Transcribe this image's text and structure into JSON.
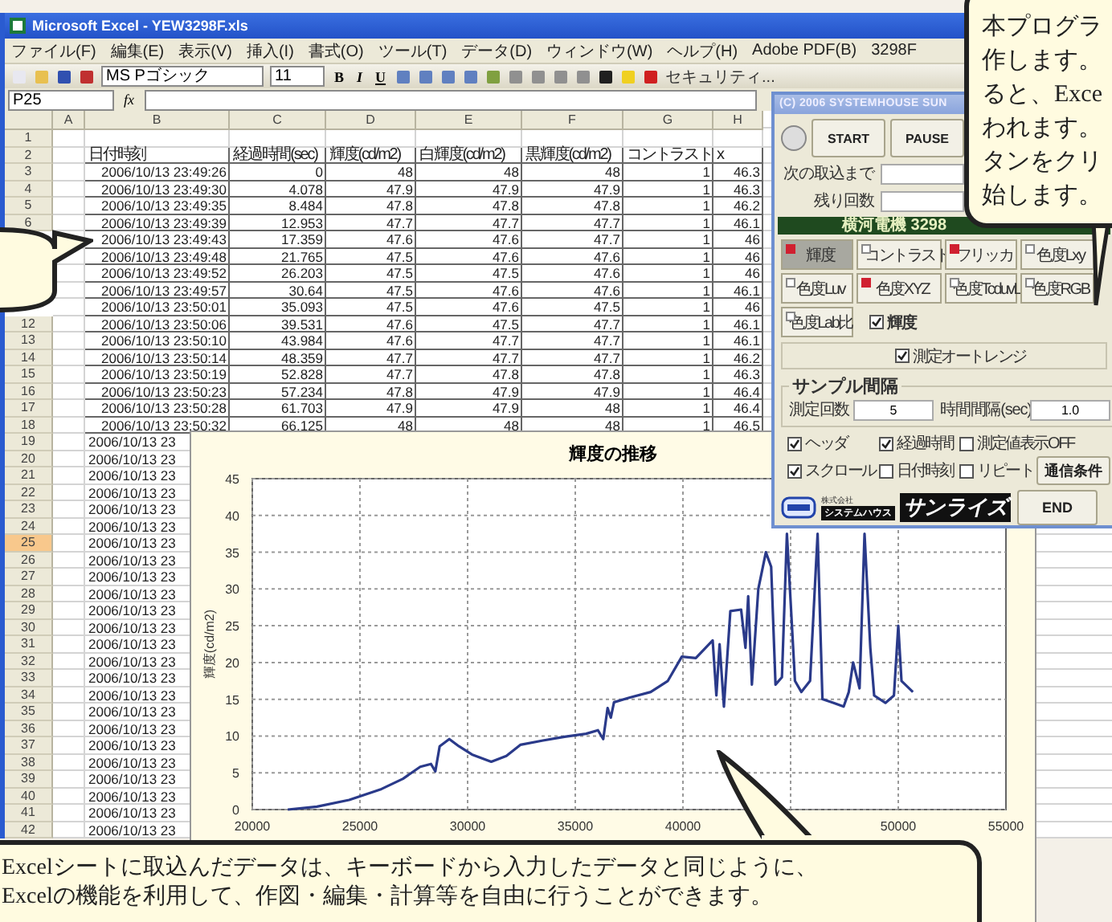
{
  "window": {
    "title": "Microsoft Excel - YEW3298F.xls"
  },
  "menu": [
    "ファイル(F)",
    "編集(E)",
    "表示(V)",
    "挿入(I)",
    "書式(O)",
    "ツール(T)",
    "データ(D)",
    "ウィンドウ(W)",
    "ヘルプ(H)",
    "Adobe PDF(B)",
    "3298F"
  ],
  "toolbar": {
    "font": "MS Pゴシック",
    "size": "11",
    "styles": [
      "B",
      "I",
      "U"
    ],
    "security": "セキュリティ..."
  },
  "formula_bar": {
    "name_box": "P25",
    "function_symbol": "fx"
  },
  "sheet": {
    "columns": [
      "A",
      "B",
      "C",
      "D",
      "E",
      "F",
      "G",
      "H"
    ],
    "rows": [
      {
        "num": "1",
        "selected": false
      },
      {
        "num": "2",
        "selected": false,
        "kind": "header",
        "cells": [
          "日付時刻",
          "経過時間(sec)",
          "輝度(cd/m2)",
          "白輝度(cd/m2)",
          "黒輝度(cd/m2)",
          "コントラスト",
          "x"
        ]
      },
      {
        "num": "3",
        "selected": false,
        "cells": [
          "2006/10/13 23:49:26",
          "0",
          "48",
          "48",
          "48",
          "1",
          "46.3"
        ]
      },
      {
        "num": "4",
        "selected": false,
        "cells": [
          "2006/10/13 23:49:30",
          "4.078",
          "47.9",
          "47.9",
          "47.9",
          "1",
          "46.3"
        ]
      },
      {
        "num": "5",
        "selected": false,
        "cells": [
          "2006/10/13 23:49:35",
          "8.484",
          "47.8",
          "47.8",
          "47.8",
          "1",
          "46.2"
        ]
      },
      {
        "num": "6",
        "selected": false,
        "cells": [
          "2006/10/13 23:49:39",
          "12.953",
          "47.7",
          "47.7",
          "47.7",
          "1",
          "46.1"
        ]
      },
      {
        "cells": [
          "2006/10/13 23:49:43",
          "17.359",
          "47.6",
          "47.6",
          "47.7",
          "1",
          "46"
        ]
      },
      {
        "cells": [
          "2006/10/13 23:49:48",
          "21.765",
          "47.5",
          "47.6",
          "47.6",
          "1",
          "46"
        ]
      },
      {
        "cells": [
          "2006/10/13 23:49:52",
          "26.203",
          "47.5",
          "47.5",
          "47.6",
          "1",
          "46"
        ]
      },
      {
        "cells": [
          "2006/10/13 23:49:57",
          "30.64",
          "47.5",
          "47.6",
          "47.6",
          "1",
          "46.1"
        ]
      },
      {
        "cells": [
          "2006/10/13 23:50:01",
          "35.093",
          "47.5",
          "47.6",
          "47.5",
          "1",
          "46"
        ]
      },
      {
        "num": "12",
        "selected": false,
        "cells": [
          "2006/10/13 23:50:06",
          "39.531",
          "47.6",
          "47.5",
          "47.7",
          "1",
          "46.1"
        ]
      },
      {
        "num": "13",
        "selected": false,
        "cells": [
          "2006/10/13 23:50:10",
          "43.984",
          "47.6",
          "47.7",
          "47.7",
          "1",
          "46.1"
        ]
      },
      {
        "num": "14",
        "selected": false,
        "cells": [
          "2006/10/13 23:50:14",
          "48.359",
          "47.7",
          "47.7",
          "47.7",
          "1",
          "46.2"
        ]
      },
      {
        "num": "15",
        "selected": false,
        "cells": [
          "2006/10/13 23:50:19",
          "52.828",
          "47.7",
          "47.8",
          "47.8",
          "1",
          "46.3"
        ]
      },
      {
        "num": "16",
        "selected": false,
        "cells": [
          "2006/10/13 23:50:23",
          "57.234",
          "47.8",
          "47.9",
          "47.9",
          "1",
          "46.4"
        ]
      },
      {
        "num": "17",
        "selected": false,
        "cells": [
          "2006/10/13 23:50:28",
          "61.703",
          "47.9",
          "47.9",
          "48",
          "1",
          "46.4"
        ]
      },
      {
        "num": "18",
        "selected": false,
        "cells": [
          "2006/10/13 23:50:32",
          "66.125",
          "48",
          "48",
          "48",
          "1",
          "46.5"
        ]
      },
      {
        "num": "19",
        "selected": false,
        "cells": [
          "2006/10/13 23"
        ]
      },
      {
        "num": "20",
        "selected": false,
        "cells": [
          "2006/10/13 23"
        ]
      },
      {
        "num": "21",
        "selected": false,
        "cells": [
          "2006/10/13 23"
        ]
      },
      {
        "num": "22",
        "selected": false,
        "cells": [
          "2006/10/13 23"
        ]
      },
      {
        "num": "23",
        "selected": false,
        "cells": [
          "2006/10/13 23"
        ]
      },
      {
        "num": "24",
        "selected": false,
        "cells": [
          "2006/10/13 23"
        ]
      },
      {
        "num": "25",
        "selected": true,
        "cells": [
          "2006/10/13 23"
        ]
      },
      {
        "num": "26",
        "selected": false,
        "cells": [
          "2006/10/13 23"
        ]
      },
      {
        "num": "27",
        "selected": false,
        "cells": [
          "2006/10/13 23"
        ]
      },
      {
        "num": "28",
        "selected": false,
        "cells": [
          "2006/10/13 23"
        ]
      },
      {
        "num": "29",
        "selected": false,
        "cells": [
          "2006/10/13 23"
        ]
      },
      {
        "num": "30",
        "selected": false,
        "cells": [
          "2006/10/13 23"
        ]
      },
      {
        "num": "31",
        "selected": false,
        "cells": [
          "2006/10/13 23"
        ]
      },
      {
        "num": "32",
        "selected": false,
        "cells": [
          "2006/10/13 23"
        ]
      },
      {
        "num": "33",
        "selected": false,
        "cells": [
          "2006/10/13 23"
        ]
      },
      {
        "num": "34",
        "selected": false,
        "cells": [
          "2006/10/13 23"
        ]
      },
      {
        "num": "35",
        "selected": false,
        "cells": [
          "2006/10/13 23"
        ]
      },
      {
        "num": "36",
        "selected": false,
        "cells": [
          "2006/10/13 23"
        ]
      },
      {
        "num": "37",
        "selected": false,
        "cells": [
          "2006/10/13 23"
        ]
      },
      {
        "num": "38",
        "selected": false,
        "cells": [
          "2006/10/13 23"
        ]
      },
      {
        "num": "39",
        "selected": false,
        "cells": [
          "2006/10/13 23"
        ]
      },
      {
        "num": "40",
        "selected": false,
        "cells": [
          "2006/10/13 23"
        ]
      },
      {
        "num": "41",
        "selected": false,
        "cells": [
          "2006/10/13 23"
        ]
      },
      {
        "num": "42",
        "selected": false,
        "cells": [
          "2006/10/13 23"
        ]
      }
    ]
  },
  "chart": {
    "chart_data": {
      "type": "line",
      "title": "輝度の推移",
      "ylabel": "輝度(cd/m2)",
      "x": [
        21650,
        23000,
        24500,
        26000,
        27000,
        27800,
        28300,
        28500,
        28700,
        29150,
        29600,
        30200,
        31100,
        31800,
        32450,
        33500,
        34500,
        35500,
        36050,
        36300,
        36500,
        36650,
        36800,
        37500,
        38500,
        39300,
        39950,
        40600,
        41380,
        41550,
        41700,
        41900,
        42200,
        42700,
        42900,
        43030,
        43200,
        43500,
        43850,
        44100,
        44300,
        44600,
        44830,
        45200,
        45500,
        45900,
        46250,
        46480,
        47000,
        47460,
        47700,
        47900,
        48200,
        48430,
        48700,
        48880,
        49400,
        49800,
        50000,
        50150,
        50680
      ],
      "grid": true,
      "series": [
        {
          "color": "#2a3a8a",
          "values": [
            0,
            0.4,
            1.3,
            2.8,
            4.2,
            5.8,
            6.2,
            5.2,
            8.6,
            9.6,
            8.6,
            7.5,
            6.5,
            7.3,
            8.8,
            9.4,
            9.9,
            10.3,
            10.8,
            9.6,
            13.8,
            12.5,
            14.6,
            15.2,
            16,
            17.5,
            20.8,
            20.6,
            23,
            15.5,
            22.5,
            14,
            27,
            27.2,
            22,
            29,
            17,
            30,
            35,
            33,
            17,
            18,
            37.5,
            17.5,
            16,
            17.5,
            37.5,
            15,
            14.5,
            14,
            16,
            20,
            16.5,
            37.5,
            22,
            15.5,
            14.5,
            15.5,
            25,
            17.5,
            16
          ]
        }
      ],
      "xlim": [
        20000,
        55000
      ],
      "ylim": [
        0,
        45
      ],
      "xticks": [
        20000,
        25000,
        30000,
        35000,
        40000,
        50000,
        55000
      ],
      "yticks": [
        0,
        5,
        10,
        15,
        20,
        25,
        30,
        35,
        40,
        45
      ]
    }
  },
  "panel": {
    "title": "(C) 2006 SYSTEMHOUSE SUN",
    "buttons": [
      "START",
      "PAUSE"
    ],
    "fields": [
      {
        "label": "次の取込まで"
      },
      {
        "label": "残り回数"
      }
    ],
    "banner": "横河電機 3298",
    "measurements": [
      {
        "label": "輝度",
        "selected": true,
        "on": true
      },
      {
        "label": "コントラスト",
        "selected": false,
        "on": false
      },
      {
        "label": "フリッカ",
        "selected": false,
        "on": true
      },
      {
        "label": "色度Lxy",
        "selected": false,
        "on": false
      },
      {
        "label": "色度Luv",
        "selected": false,
        "on": false
      },
      {
        "label": "色度XYZ",
        "selected": false,
        "on": true
      },
      {
        "label": "色度TcduvL",
        "selected": false,
        "on": false
      },
      {
        "label": "色度RGB",
        "selected": false,
        "on": false
      },
      {
        "label": "色度Lab比",
        "selected": false,
        "on": false
      }
    ],
    "display_check": {
      "label": "輝度",
      "checked": true
    },
    "autorange": {
      "label": "測定オートレンジ",
      "checked": true
    },
    "sample": {
      "title": "サンプル間隔",
      "count_label": "測定回数",
      "count": "5",
      "interval_label": "時間間隔(sec)",
      "interval": "1.0"
    },
    "options": [
      {
        "label": "ヘッダ",
        "checked": true
      },
      {
        "label": "経過時間",
        "checked": true
      },
      {
        "label": "測定値表示OFF",
        "checked": false
      },
      {
        "label": "スクロール",
        "checked": true
      },
      {
        "label": "日付時刻",
        "checked": false
      },
      {
        "label": "リピート",
        "checked": false
      }
    ],
    "comm_button": "通信条件",
    "end_button": "END",
    "logo": {
      "company_type": "株式会社",
      "division": "システムハウス",
      "name": "サンライズ"
    }
  },
  "top_callout": {
    "lines": [
      "本プログラ",
      "作します。",
      "ると、Exce",
      "われます。",
      "タンをクリ",
      "始します。"
    ]
  },
  "bottom_callout": {
    "lines": [
      "Excelシートに取込んだデータは、キーボードから入力したデータと同じように、",
      "Excelの機能を利用して、作図・編集・計算等を自由に行うことができます。"
    ]
  }
}
